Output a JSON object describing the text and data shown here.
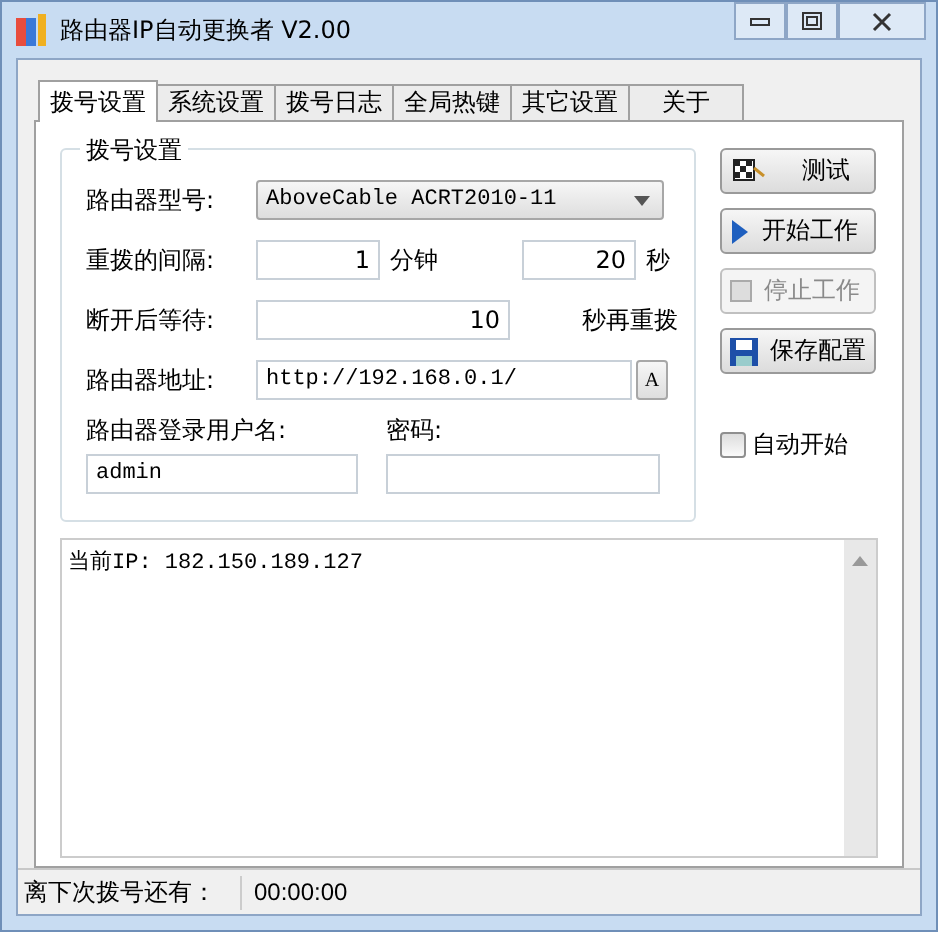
{
  "window": {
    "title": "路由器IP自动更换者 V2.00"
  },
  "tabs": [
    {
      "label": "拨号设置",
      "selected": true
    },
    {
      "label": "系统设置",
      "selected": false
    },
    {
      "label": "拨号日志",
      "selected": false
    },
    {
      "label": "全局热键",
      "selected": false
    },
    {
      "label": "其它设置",
      "selected": false
    },
    {
      "label": "关于",
      "selected": false
    }
  ],
  "dial_group": {
    "title": "拨号设置",
    "router_model": {
      "label": "路由器型号:",
      "value": "AboveCable ACRT2010-11"
    },
    "interval": {
      "label": "重拨的间隔:",
      "minutes": "1",
      "minutes_unit": "分钟",
      "seconds": "20",
      "seconds_unit": "秒"
    },
    "wait": {
      "label": "断开后等待:",
      "value": "10",
      "unit": "秒再重拨"
    },
    "address": {
      "label": "路由器地址:",
      "value": "http://192.168.0.1/",
      "button": "A"
    },
    "username": {
      "label": "路由器登录用户名:",
      "value": "admin"
    },
    "password": {
      "label": "密码:"
    }
  },
  "actions": [
    {
      "kind": "flag",
      "label": "测试",
      "disabled": false
    },
    {
      "kind": "play",
      "label": "开始工作",
      "disabled": false
    },
    {
      "kind": "stop",
      "label": "停止工作",
      "disabled": true
    },
    {
      "kind": "save",
      "label": "保存配置",
      "disabled": false
    }
  ],
  "auto_start": {
    "label": "自动开始",
    "checked": false
  },
  "log": {
    "lines": [
      "当前IP: 182.150.189.127"
    ]
  },
  "status_bar": {
    "label": "离下次拨号还有：",
    "value": "00:00:00"
  }
}
